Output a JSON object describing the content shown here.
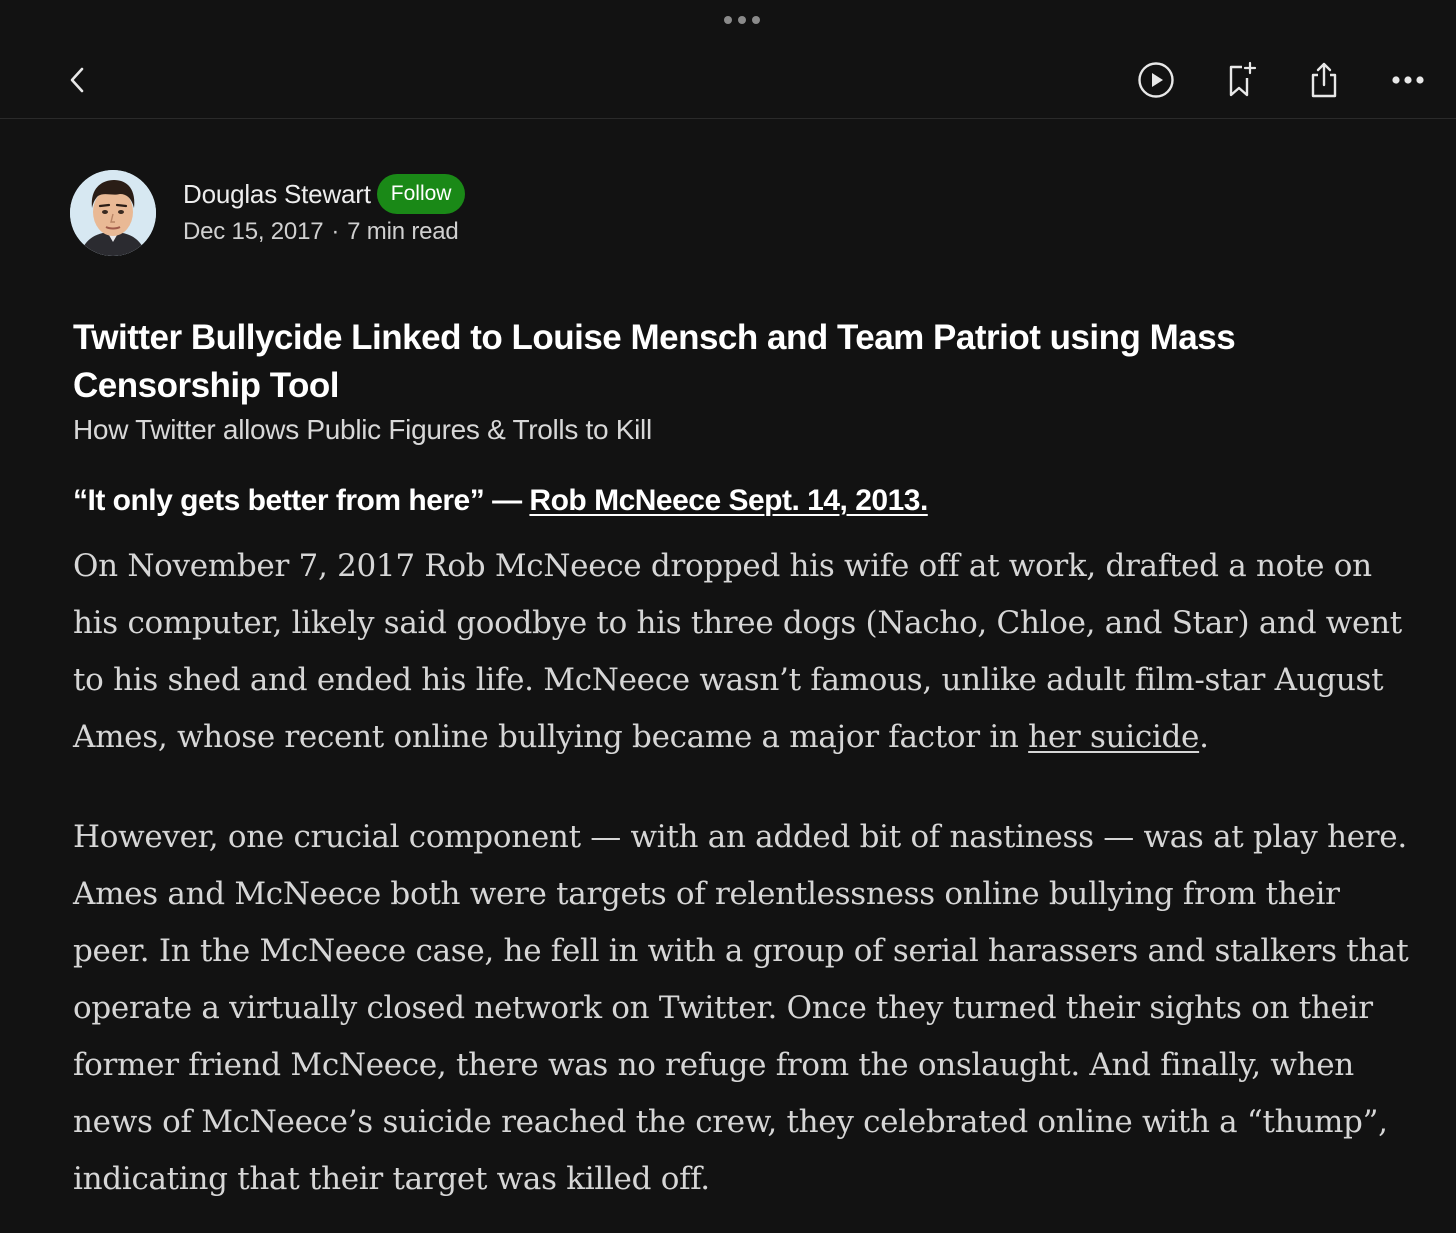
{
  "toolbar": {
    "back_icon": "chevron-left-icon",
    "listen_icon": "play-circle-icon",
    "save_icon": "bookmark-add-icon",
    "share_icon": "share-icon",
    "more_icon": "more-horizontal-icon"
  },
  "author": {
    "name": "Douglas Stewart",
    "follow_label": "Follow",
    "date": "Dec 15, 2017",
    "separator": "·",
    "read_time": "7 min read"
  },
  "article": {
    "title": "Twitter Bullycide Linked to Louise Mensch and Team Patriot using Mass Censorship Tool",
    "subtitle": "How Twitter allows Public Figures & Trolls to Kill",
    "quote_text": "“It only gets better from here” — ",
    "quote_link": "Rob McNeece Sept. 14, 2013.",
    "para1_text": "On November 7, 2017 Rob McNeece dropped his wife off at work, drafted a note on his computer, likely said goodbye to his three dogs (Nacho, Chloe, and Star) and went to his shed and ended his life. McNeece wasn’t famous, unlike adult film-star August Ames, whose recent online bullying became a major factor in ",
    "para1_link": "her suicide",
    "para1_end": ".",
    "para2_text": "However, one crucial component — with an added bit of nastiness — was at play here. Ames and McNeece both were targets of relentlessness online bullying from their peer. In the McNeece case, he fell in with a group of serial harassers and stalkers that operate a virtually closed network on Twitter. Once they turned their sights on their former friend McNeece, there was no refuge from the onslaught. And finally, when news of McNeece’s suicide reached the crew, they celebrated online with a “thump”, indicating that their target was killed off."
  },
  "colors": {
    "background": "#121212",
    "follow_button": "#1a8917",
    "text": "#ededed"
  }
}
